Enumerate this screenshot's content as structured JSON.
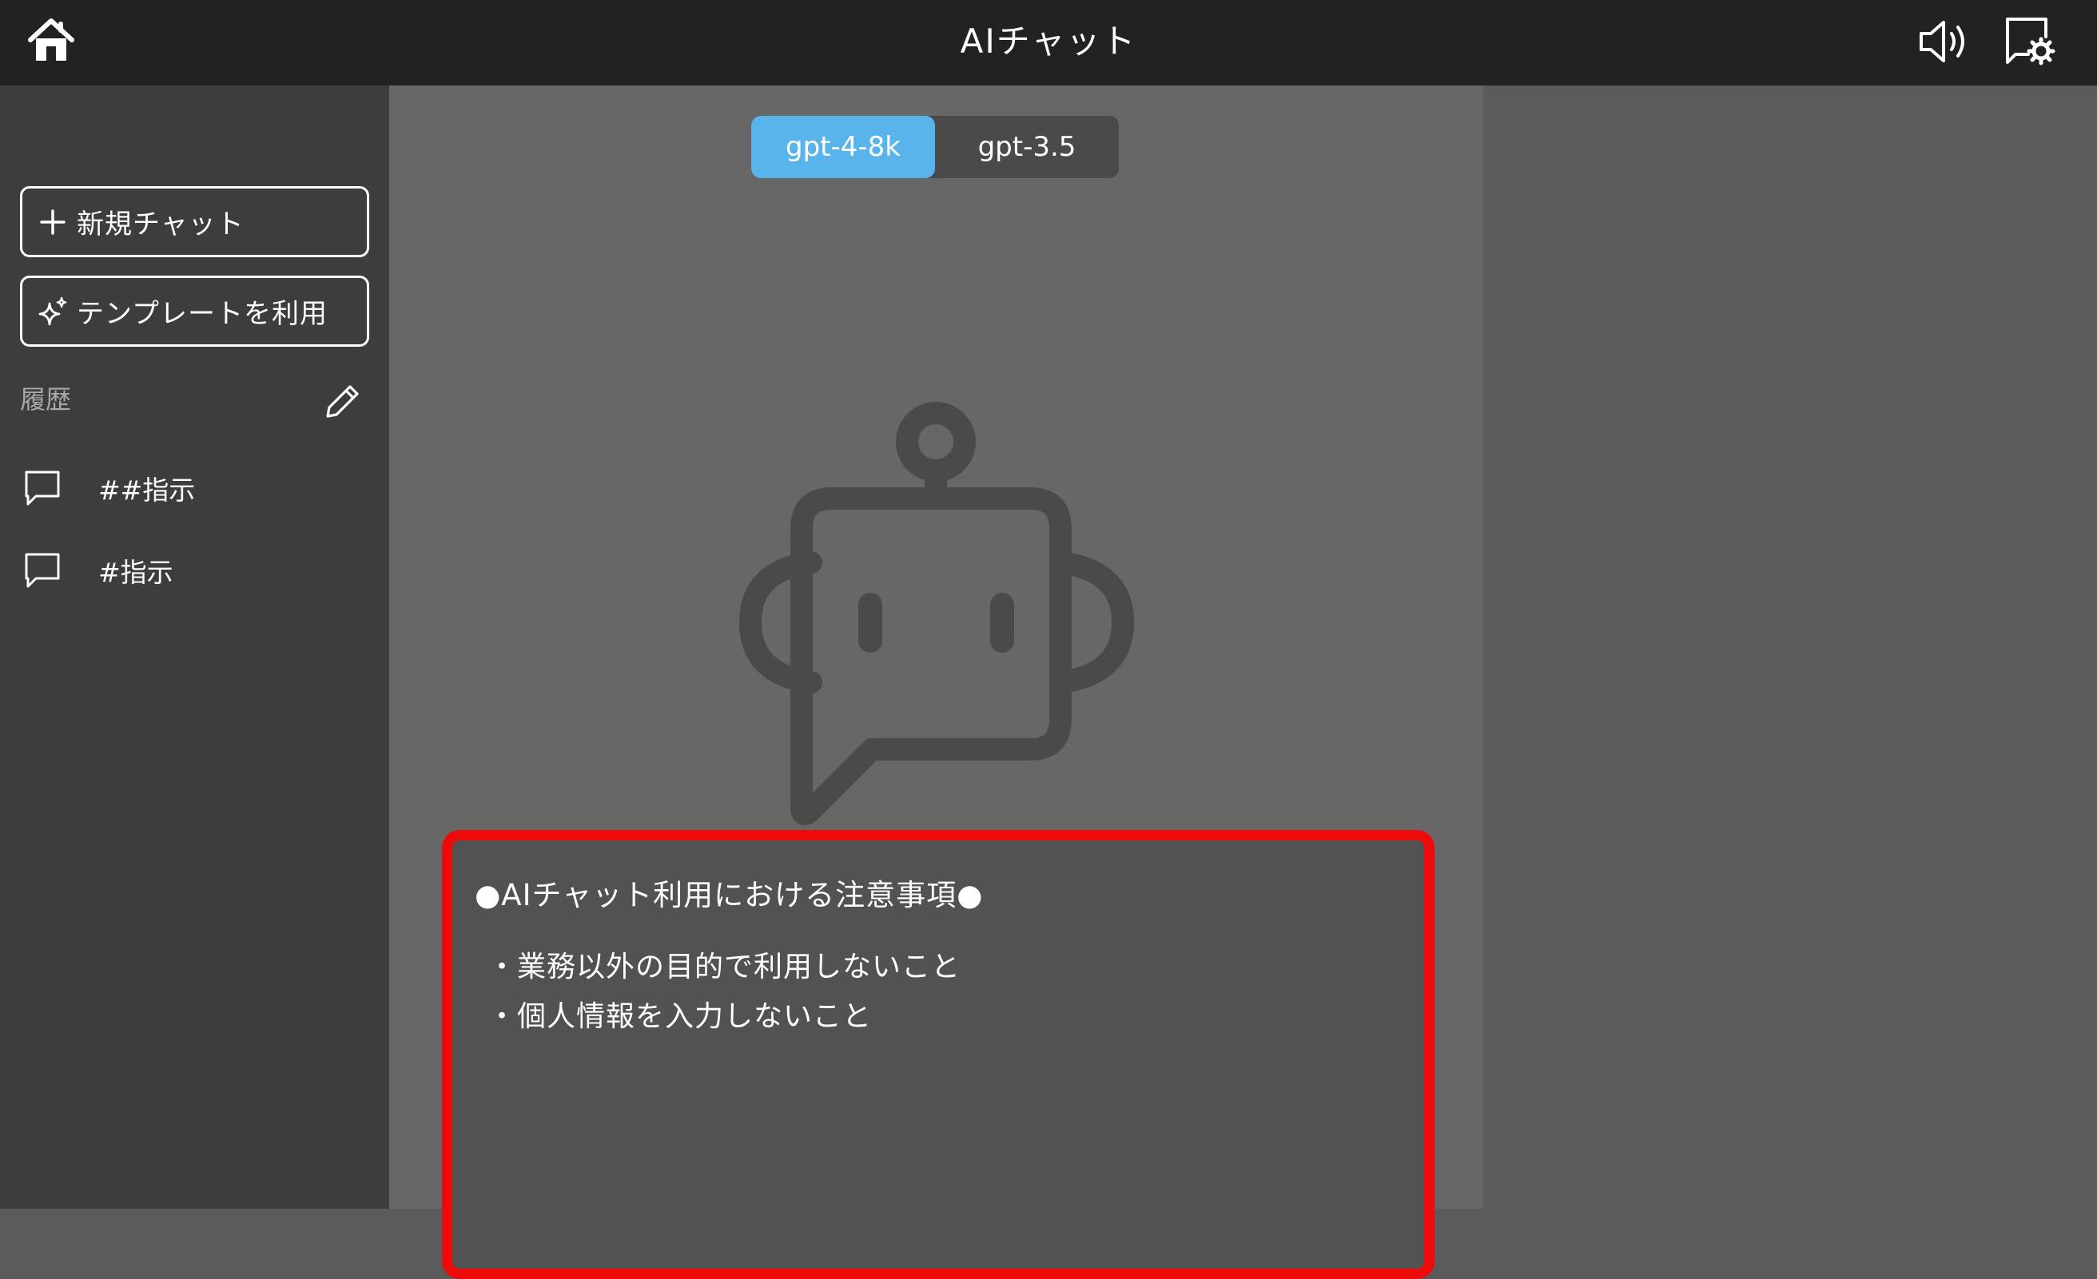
{
  "header": {
    "title": "AIチャット",
    "home_icon": "home-icon",
    "speaker_icon": "speaker-icon",
    "settings_icon": "chat-settings-icon"
  },
  "sidebar": {
    "new_chat_label": "新規チャット",
    "template_label": "テンプレートを利用",
    "history_label": "履歴",
    "history_items": [
      {
        "label": "##指示"
      },
      {
        "label": "#指示"
      }
    ]
  },
  "main": {
    "models": [
      {
        "label": "gpt-4-8k",
        "active": true
      },
      {
        "label": "gpt-3.5",
        "active": false
      }
    ],
    "notice": {
      "title": "●AIチャット利用における注意事項●",
      "lines": [
        "・業務以外の目的で利用しないこと",
        "・個人情報を入力しないこと"
      ]
    }
  },
  "colors": {
    "topbar": "#222222",
    "sidebar": "#3d3d3d",
    "main": "#676767",
    "accent": "#5ab4ec",
    "notice_border": "#ee0a0a",
    "robot": "#4a4a4a"
  }
}
